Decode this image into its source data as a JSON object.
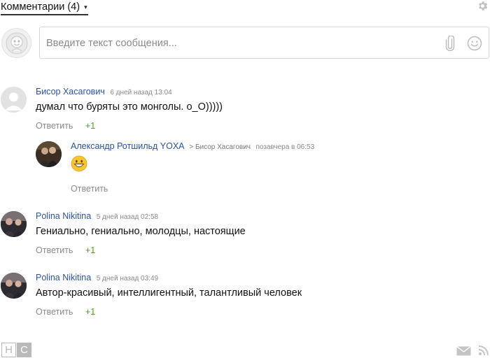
{
  "header": {
    "title": "Комментарии (4)",
    "caret": "▾"
  },
  "composer": {
    "placeholder": "Введите текст сообщения..."
  },
  "comments": [
    {
      "author": "Бисор Хасагович",
      "time": "6 дней назад 13:04",
      "text": "думал что буряты это монголы. о_О)))))",
      "reply_label": "Ответить",
      "plus": "+1",
      "replies": [
        {
          "author": "Александр Ротшильд YOXA",
          "reply_to": "> Бисор Хасагович",
          "time": "позавчера в 06:53",
          "reply_label": "Ответить",
          "emoji": "smiley-emoji"
        }
      ]
    },
    {
      "author": "Polina Nikitina",
      "time": "5 дней назад 02:58",
      "text": "Гениально, гениально, молодцы, настоящие",
      "reply_label": "Ответить",
      "plus": "+1"
    },
    {
      "author": "Polina Nikitina",
      "time": "5 дней назад 03:49",
      "text": "Автор-красивый, интеллигентный, талантливый человек",
      "reply_label": "Ответить",
      "plus": "+1"
    }
  ],
  "footer": {
    "logo_letters": [
      "H",
      "C"
    ]
  },
  "colors": {
    "author": "#2b53a0",
    "plus": "#4aa020",
    "meta": "#888888",
    "icon": "#bdbdbd"
  }
}
